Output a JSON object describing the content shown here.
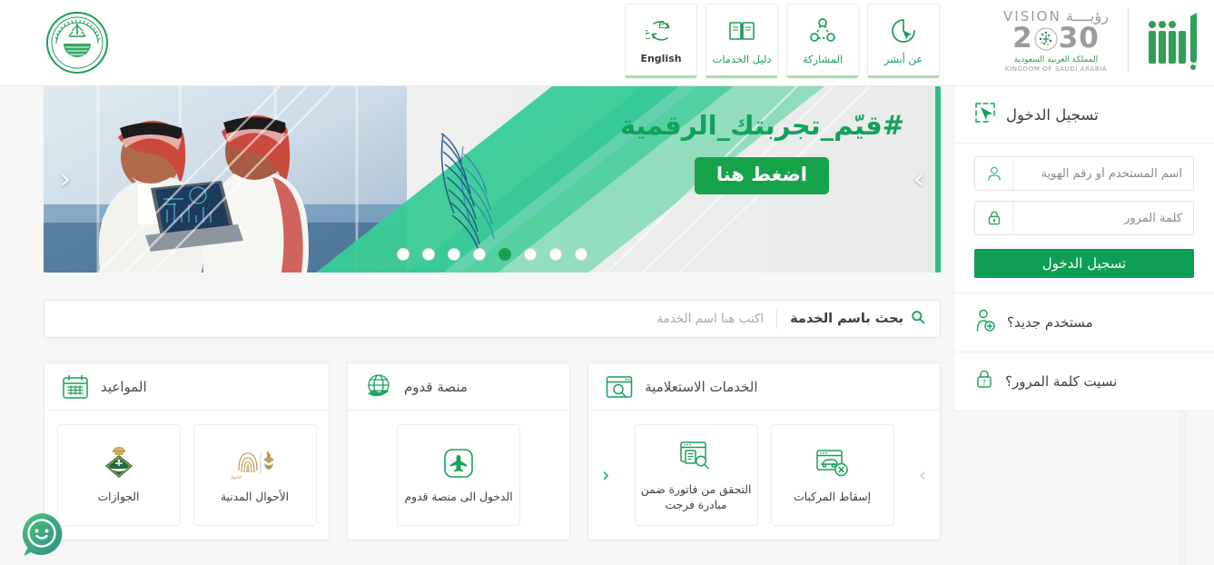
{
  "header": {
    "emblem_alt": "moi-emblem",
    "nav": [
      {
        "label": "عن أبشر",
        "icon": "about-cursor-icon"
      },
      {
        "label": "المشاركة",
        "icon": "share-network-icon"
      },
      {
        "label": "دليل الخدمات",
        "icon": "services-guide-book-icon"
      },
      {
        "label": "English",
        "icon": "language-switch-icon"
      }
    ],
    "vision": {
      "word_en": "VISION",
      "word_ar": "رؤيــــة",
      "year": "2030",
      "sub_ar": "المملكة العربية السعودية",
      "sub_en": "KINGDOM OF SAUDI ARABIA"
    },
    "absher_logo_alt": "absher-wordmark"
  },
  "hero": {
    "title": "#قيّم_تجربتك_الرقمية",
    "cta": "اضغط هنا",
    "dots_total": 8,
    "active_dot": 3,
    "prev_label": "‹",
    "next_label": "›"
  },
  "search": {
    "label": "بحث باسم الخدمة",
    "placeholder": "اكتب هنا اسم الخدمة",
    "value": "",
    "icon": "search-icon"
  },
  "cards": [
    {
      "title": "الخدمات الاستعلامية",
      "icon": "browser-search-icon",
      "prev_enabled": true,
      "next_enabled": false,
      "prev_label": "‹",
      "next_label": "›",
      "tiles": [
        {
          "label": "التحقق من فاتورة ضمن مبادرة فرجت",
          "icon": "invoice-verify-icon"
        },
        {
          "label": "إسقاط المركبات",
          "icon": "vehicle-deregister-icon"
        }
      ]
    },
    {
      "title": "منصة قدوم",
      "icon": "globe-plane-icon",
      "tiles": [
        {
          "label": "الدخول الى منصة قدوم",
          "icon": "airplane-icon"
        }
      ]
    },
    {
      "title": "المواعيد",
      "icon": "calendar-icon",
      "tiles": [
        {
          "label": "الجوازات",
          "icon": "passports-emblem-icon"
        },
        {
          "label": "الأحوال المدنية",
          "icon": "civil-affairs-fingerprint-icon"
        }
      ]
    }
  ],
  "login": {
    "title": "تسجيل الدخول",
    "title_icon": "login-cursor-icon",
    "username": {
      "placeholder": "اسم المستخدم أو رقم الهوية",
      "value": "",
      "icon": "user-icon"
    },
    "password": {
      "placeholder": "كلمة المرور",
      "value": "",
      "icon": "lock-icon"
    },
    "submit": "تسجيل الدخول",
    "new_user": {
      "label": "مستخدم جديد؟",
      "icon": "user-add-icon"
    },
    "forgot_password": {
      "label": "نسيت كلمة المرور؟",
      "icon": "lock-question-icon"
    }
  },
  "chat": {
    "icon": "chat-bot-icon",
    "label": ""
  },
  "colors": {
    "brand_green": "#0d9d53",
    "accent_green": "#17a05a",
    "light_green": "#8fe09a",
    "teal": "#2ecc9b",
    "text_dark": "#3f3f3f",
    "muted": "#9a9a9a"
  }
}
